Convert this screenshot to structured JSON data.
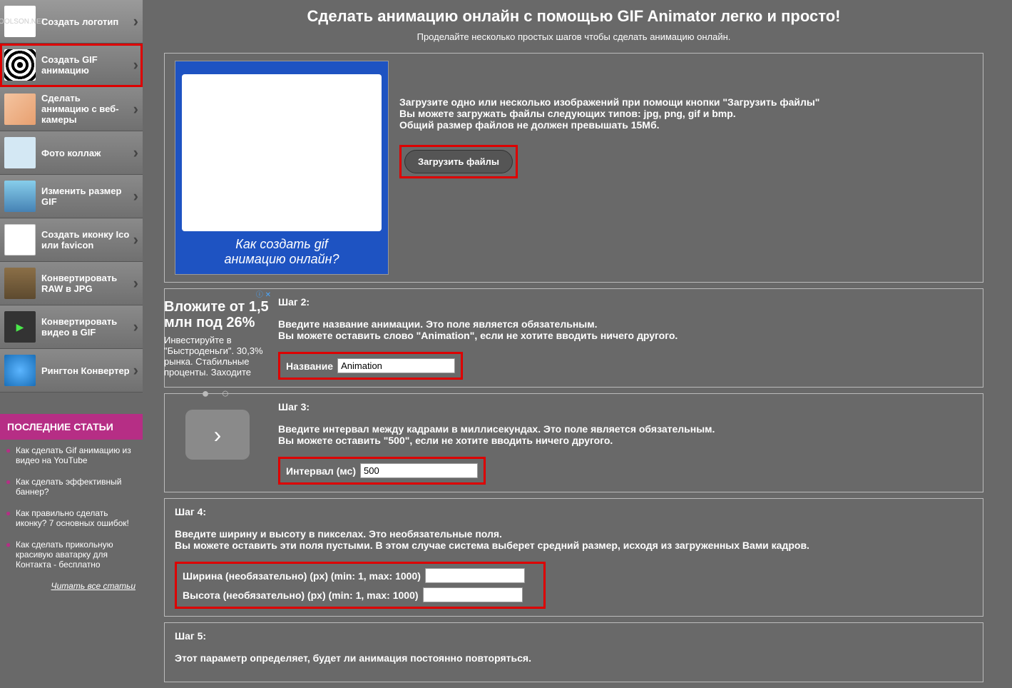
{
  "nav": {
    "items": [
      {
        "label": "Создать логотип"
      },
      {
        "label": "Создать GIF анимацию"
      },
      {
        "label": "Сделать анимацию с веб-камеры"
      },
      {
        "label": "Фото коллаж"
      },
      {
        "label": "Изменить размер GIF"
      },
      {
        "label": "Создать иконку Ico или favicon"
      },
      {
        "label": "Конвертировать RAW в JPG"
      },
      {
        "label": "Конвертировать видео в GIF"
      },
      {
        "label": "Рингтон Конвертер"
      }
    ]
  },
  "articles": {
    "header": "ПОСЛЕДНИЕ СТАТЬИ",
    "items": [
      "Как сделать Gif анимацию из видео на YouTube",
      "Как сделать эффективный баннер?",
      "Как правильно сделать иконку? 7 основных ошибок!",
      "Как сделать прикольную красивую аватарку для Контакта - бесплатно"
    ],
    "read_all": "Читать все статьи"
  },
  "page": {
    "title": "Сделать анимацию онлайн с помощью GIF Animator легко и просто!",
    "subtitle": "Проделайте несколько простых шагов чтобы сделать анимацию онлайн."
  },
  "preview": {
    "line1": "Как создать gif",
    "line2": "анимацию онлайн?"
  },
  "step1": {
    "text1": "Загрузите одно или несколько изображений при помощи кнопки \"Загрузить файлы\"",
    "text2": "Вы можете загружать файлы следующих типов: jpg, png, gif и bmp.",
    "text3": "Общий размер файлов не должен превышать 15Мб.",
    "upload_btn": "Загрузить файлы"
  },
  "ad": {
    "headline": "Вложите от 1,5 млн под 26%",
    "body": "Инвестируйте в \"Быстроденьги\". 30,3% рынка. Стабильные проценты. Заходите"
  },
  "step2": {
    "label": "Шаг 2:",
    "text1": "Введите название анимации. Это поле является обязательным.",
    "text2": "Вы можете оставить слово \"Animation\", если не хотите вводить ничего другого.",
    "input_label": "Название",
    "input_value": "Animation"
  },
  "step3": {
    "label": "Шаг 3:",
    "text1": "Введите интервал между кадрами в миллисекундах. Это поле является обязательным.",
    "text2": "Вы можете оставить \"500\", если не хотите вводить ничего другого.",
    "input_label": "Интервал (мс)",
    "input_value": "500"
  },
  "step4": {
    "label": "Шаг 4:",
    "text1": "Введите ширину и высоту в пикселах. Это необязательные поля.",
    "text2": "Вы можете оставить эти поля пустыми. В этом случае система выберет средний размер, исходя из загруженных Вами кадров.",
    "width_label": "Ширина (необязательно) (px) (min: 1, max: 1000)",
    "height_label": "Высота (необязательно) (px) (min: 1, max: 1000)"
  },
  "step5": {
    "label": "Шаг 5:",
    "text": "Этот параметр определяет, будет ли анимация постоянно повторяться."
  }
}
